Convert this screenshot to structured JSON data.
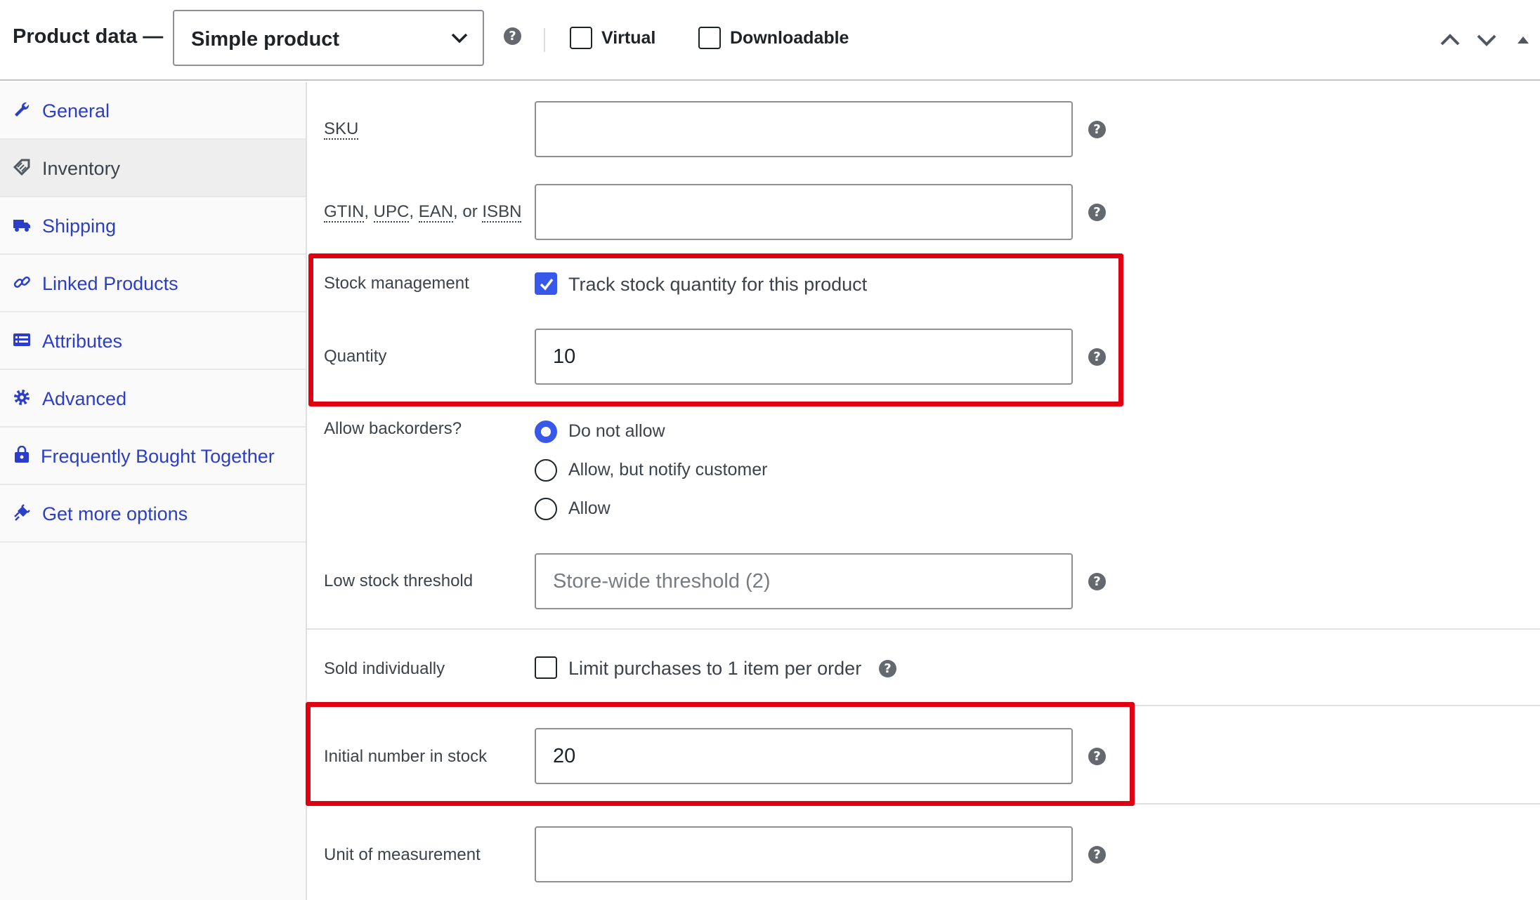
{
  "header": {
    "title": "Product data —",
    "product_type": "Simple product",
    "virtual_label": "Virtual",
    "downloadable_label": "Downloadable",
    "virtual_checked": false,
    "downloadable_checked": false
  },
  "sidebar": {
    "items": [
      {
        "label": "General",
        "icon": "wrench-icon",
        "active": false
      },
      {
        "label": "Inventory",
        "icon": "tag-icon",
        "active": true
      },
      {
        "label": "Shipping",
        "icon": "truck-icon",
        "active": false
      },
      {
        "label": "Linked Products",
        "icon": "link-icon",
        "active": false
      },
      {
        "label": "Attributes",
        "icon": "list-icon",
        "active": false
      },
      {
        "label": "Advanced",
        "icon": "gear-icon",
        "active": false
      },
      {
        "label": "Frequently Bought Together",
        "icon": "bag-icon",
        "active": false
      },
      {
        "label": "Get more options",
        "icon": "plug-icon",
        "active": false
      }
    ]
  },
  "inventory": {
    "sku_label": "SKU",
    "sku_value": "",
    "gtin_parts": [
      "GTIN",
      ", ",
      "UPC",
      ", ",
      "EAN",
      ", or ",
      "ISBN"
    ],
    "gtin_value": "",
    "stock_management_label": "Stock management",
    "track_stock_label": "Track stock quantity for this product",
    "track_stock_checked": true,
    "quantity_label": "Quantity",
    "quantity_value": "10",
    "backorders_label": "Allow backorders?",
    "backorder_options": [
      {
        "label": "Do not allow",
        "selected": true
      },
      {
        "label": "Allow, but notify customer",
        "selected": false
      },
      {
        "label": "Allow",
        "selected": false
      }
    ],
    "low_stock_label": "Low stock threshold",
    "low_stock_placeholder": "Store-wide threshold (2)",
    "sold_individually_label": "Sold individually",
    "limit_purchases_label": "Limit purchases to 1 item per order",
    "limit_purchases_checked": false,
    "initial_stock_label": "Initial number in stock",
    "initial_stock_value": "20",
    "unit_label": "Unit of measurement",
    "unit_value": ""
  },
  "colors": {
    "accent": "#3858e9",
    "link": "#2c3ec7",
    "highlight": "#e00012"
  },
  "help_glyph": "?"
}
